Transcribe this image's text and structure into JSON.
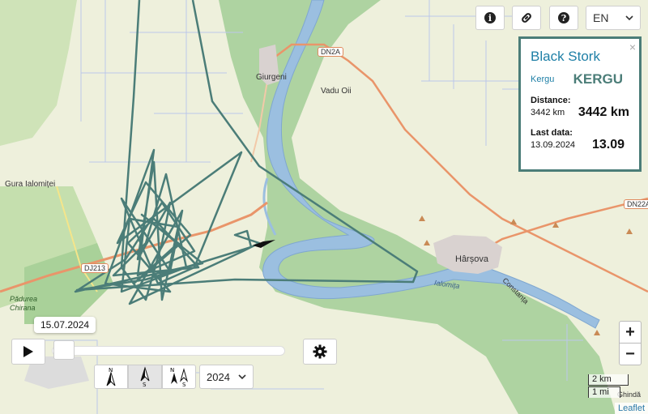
{
  "map": {
    "labels": {
      "dn2a": "DN2A",
      "giurgeni": "Giurgeni",
      "vadu_oii": "Vadu Oii",
      "gura_ialomitei": "Gura Ialomiței",
      "harsova": "Hârșova",
      "dn22a": "DN22A",
      "dj213": "DJ213",
      "ialomita": "Ialomița",
      "padurea_chirana_1": "Pădurea",
      "padurea_chirana_2": "Chirana",
      "constanta": "Constanța",
      "ghindaresti": "Ghindă"
    },
    "colors": {
      "track": "#4b7d78",
      "river": "#9bbfe0",
      "floodplain": "#aed3a1",
      "road": "#e9956a"
    }
  },
  "toolbar": {
    "info_icon": "info-icon",
    "link_icon": "link-icon",
    "help_icon": "help-icon",
    "language": "EN"
  },
  "bird_panel": {
    "species": "Black Stork",
    "close": "×",
    "name_small": "Kergu",
    "name_code": "KERGU",
    "distance_label": "Distance:",
    "distance_small": "3442 km",
    "distance_big": "3442 km",
    "last_label": "Last data:",
    "last_small": "13.09.2024",
    "last_big": "13.09"
  },
  "player": {
    "date_tooltip": "15.07.2024",
    "progress": 0.0,
    "year": "2024",
    "direction_n": "N",
    "direction_s": "S"
  },
  "zoom": {
    "plus": "+",
    "minus": "−"
  },
  "scale": {
    "km": "2 km",
    "mi": "1 mi"
  },
  "attribution": "Leaflet"
}
